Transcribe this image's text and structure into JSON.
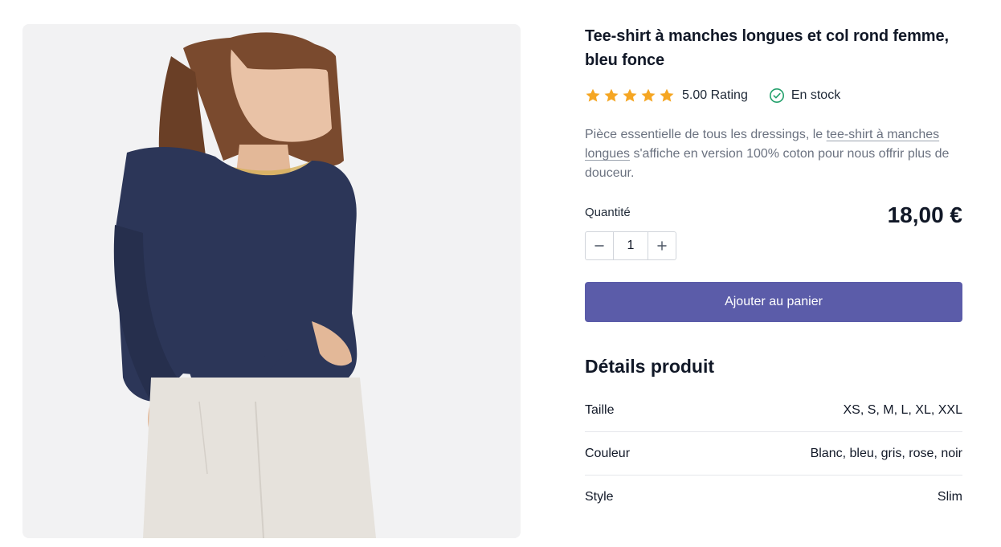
{
  "product": {
    "title": "Tee-shirt à manches longues et col rond femme, bleu fonce",
    "rating_text": "5.00 Rating",
    "rating_value": 5,
    "stock_text": "En stock",
    "description_before": "Pièce essentielle de tous les dressings, le ",
    "description_link": "tee-shirt à manches longues",
    "description_after": " s'affiche en version 100% coton pour nous offrir plus de douceur.",
    "quantity_label": "Quantité",
    "quantity_value": "1",
    "price": "18,00 €",
    "add_to_cart_label": "Ajouter au panier"
  },
  "details": {
    "title": "Détails produit",
    "rows": [
      {
        "label": "Taille",
        "value": "XS, S, M, L, XL, XXL"
      },
      {
        "label": "Couleur",
        "value": "Blanc, bleu, gris, rose, noir"
      },
      {
        "label": "Style",
        "value": "Slim"
      }
    ]
  },
  "icons": {
    "star": "star-icon",
    "stock": "check-circle-icon",
    "minus": "minus-icon",
    "plus": "plus-icon"
  },
  "colors": {
    "accent": "#5b5ca9",
    "star": "#f5a623",
    "stock": "#22a06b"
  }
}
